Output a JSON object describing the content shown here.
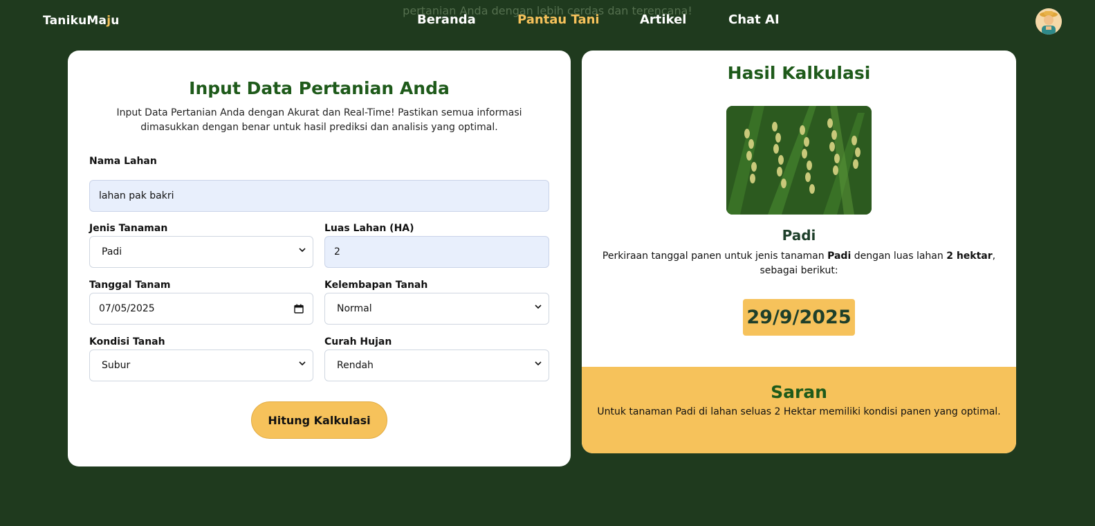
{
  "hero": {
    "faded_line_1": "",
    "faded_line_2": "pertanian Anda dengan lebih cerdas dan terencana!"
  },
  "brand": {
    "name_part_1": "TanikuMa",
    "name_accent": "j",
    "name_part_2": "u"
  },
  "nav": {
    "items": [
      {
        "label": "Beranda"
      },
      {
        "label": "Pantau Tani"
      },
      {
        "label": "Artikel"
      },
      {
        "label": "Chat AI"
      }
    ],
    "active_index": 1
  },
  "form": {
    "title": "Input Data Pertanian Anda",
    "subtitle": "Input Data Pertanian Anda dengan Akurat dan Real-Time! Pastikan semua informasi dimasukkan dengan benar untuk hasil prediksi dan analisis yang optimal.",
    "nama_lahan": {
      "label": "Nama Lahan",
      "value": "lahan pak bakri"
    },
    "jenis_tanaman": {
      "label": "Jenis Tanaman",
      "value": "Padi"
    },
    "luas_lahan": {
      "label": "Luas Lahan (HA)",
      "value": "2"
    },
    "tanggal_tanam": {
      "label": "Tanggal Tanam",
      "value": "07/05/2025"
    },
    "kelembapan": {
      "label": "Kelembapan Tanah",
      "value": "Normal"
    },
    "kondisi": {
      "label": "Kondisi Tanah",
      "value": "Subur"
    },
    "curah_hujan": {
      "label": "Curah Hujan",
      "value": "Rendah"
    },
    "submit_label": "Hitung Kalkulasi"
  },
  "result": {
    "title": "Hasil Kalkulasi",
    "crop_name": "Padi",
    "estimate_prefix": "Perkiraan tanggal panen untuk jenis tanaman ",
    "estimate_crop": "Padi",
    "estimate_mid": " dengan luas lahan ",
    "estimate_area": "2 hektar",
    "estimate_suffix": ", sebagai berikut:",
    "harvest_date": "29/9/2025",
    "saran_title": "Saran",
    "saran_text": "Untuk tanaman Padi di lahan seluas 2 Hektar memiliki kondisi panen yang optimal."
  },
  "colors": {
    "background": "#1f3a1e",
    "accent": "#f6c25b",
    "heading_green": "#1e5a1a"
  }
}
